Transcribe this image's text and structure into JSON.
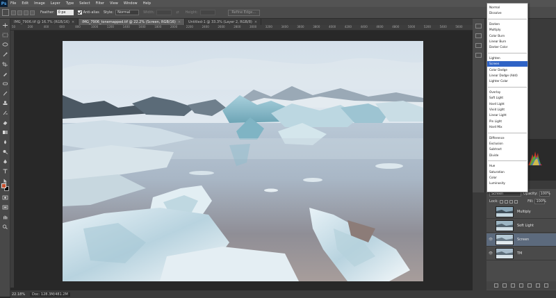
{
  "app": {
    "logo": "Ps"
  },
  "menu": [
    "File",
    "Edit",
    "Image",
    "Layer",
    "Type",
    "Select",
    "Filter",
    "View",
    "Window",
    "Help"
  ],
  "options": {
    "feather_label": "Feather:",
    "feather_value": "0 px",
    "antialias_label": "Anti-alias",
    "style_label": "Style:",
    "style_value": "Normal",
    "width_label": "Width:",
    "height_label": "Height:",
    "refine_label": "Refine Edge..."
  },
  "tabs": [
    {
      "label": "IMG_7906.tif @ 16.7% (RGB/16)",
      "active": false
    },
    {
      "label": "IMG_7906_tonemapped.tif @ 22.2% (Screen, RGB/16)",
      "active": true
    },
    {
      "label": "Untitled-1 @ 33.3% (Layer 2, RGB/8)",
      "active": false
    }
  ],
  "ruler": [
    "50",
    "200",
    "400",
    "600",
    "800",
    "1000",
    "1200",
    "1400",
    "1600",
    "1800",
    "2000",
    "2200",
    "2400",
    "2600",
    "2800",
    "3000",
    "3200",
    "3400",
    "3600",
    "3800",
    "4000",
    "4200",
    "4400",
    "4600",
    "4800",
    "5000",
    "5200",
    "5400",
    "5600"
  ],
  "status": {
    "zoom": "22.18%",
    "doc": "Doc: 128.3M/481.2M"
  },
  "blend_modes": [
    [
      "Normal",
      "Dissolve"
    ],
    [
      "Darken",
      "Multiply",
      "Color Burn",
      "Linear Burn",
      "Darker Color"
    ],
    [
      "Lighten",
      "Screen",
      "Color Dodge",
      "Linear Dodge (Add)",
      "Lighter Color"
    ],
    [
      "Overlay",
      "Soft Light",
      "Hard Light",
      "Vivid Light",
      "Linear Light",
      "Pin Light",
      "Hard Mix"
    ],
    [
      "Difference",
      "Exclusion",
      "Subtract",
      "Divide"
    ],
    [
      "Hue",
      "Saturation",
      "Color",
      "Luminosity"
    ]
  ],
  "blend_selected": "Screen",
  "layers_panel": {
    "blend_value": "Screen",
    "opacity_label": "Opacity:",
    "opacity_value": "100%",
    "lock_label": "Lock:",
    "fill_label": "Fill:",
    "fill_value": "100%",
    "layers": [
      {
        "name": "Multiply",
        "visible": false,
        "selected": false
      },
      {
        "name": "Soft Light",
        "visible": false,
        "selected": false
      },
      {
        "name": "Screen",
        "visible": true,
        "selected": true
      },
      {
        "name": "TM",
        "visible": true,
        "selected": false
      }
    ]
  },
  "colors": {
    "foreground": "#c8502e",
    "background": "#000000",
    "selection": "#2f63c5"
  }
}
